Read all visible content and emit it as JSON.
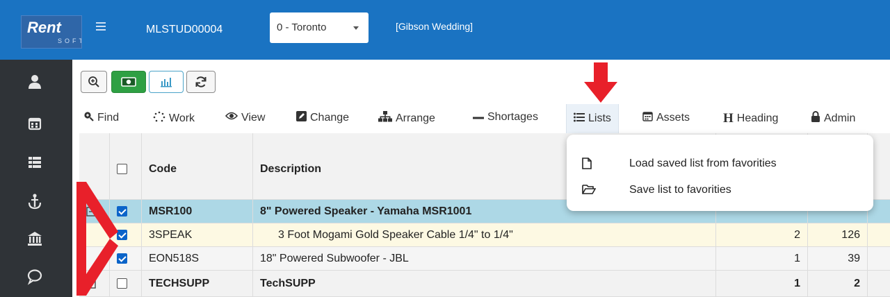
{
  "topbar": {
    "logo_text": "Rent",
    "logo_sub": "SOFT",
    "order_id": "MLSTUD00004",
    "location": "0 - Toronto",
    "event_name": "[Gibson Wedding]"
  },
  "sidebar": {
    "items": [
      "user-icon",
      "calendar-icon",
      "list-icon",
      "anchor-icon",
      "bank-icon",
      "chat-icon"
    ]
  },
  "toolbar": {
    "buttons": [
      "zoom-icon",
      "money-icon",
      "bar-chart-icon",
      "refresh-icon"
    ]
  },
  "nav": {
    "find": "Find",
    "work": "Work",
    "view": "View",
    "change": "Change",
    "arrange": "Arrange",
    "shortages": "Shortages",
    "lists": "Lists",
    "assets": "Assets",
    "heading": "Heading",
    "admin": "Admin"
  },
  "table": {
    "headers": {
      "code": "Code",
      "description": "Description"
    },
    "rows": [
      {
        "code": "MSR100",
        "description": "8\" Powered Speaker - Yamaha MSR1001",
        "checked": true,
        "bold": true,
        "qty": "",
        "avail": ""
      },
      {
        "code": "3SPEAK",
        "description": "3 Foot Mogami Gold Speaker Cable 1/4\" to 1/4\"",
        "checked": true,
        "bold": false,
        "qty": "2",
        "avail": "126"
      },
      {
        "code": "EON518S",
        "description": "18\" Powered Subwoofer - JBL",
        "checked": true,
        "bold": false,
        "qty": "1",
        "avail": "39"
      },
      {
        "code": "TECHSUPP",
        "description": "TechSUPP",
        "checked": false,
        "bold": true,
        "qty": "1",
        "avail": "2"
      }
    ]
  },
  "dropdown": {
    "load_label": "Load saved list from favorities",
    "save_label": "Save list to favorities"
  },
  "colors": {
    "topbar": "#1a73c2",
    "sidebar": "#2f3337",
    "selected_row": "#add8e6",
    "highlight_row": "#fdf9e3",
    "annotation": "#e8202a"
  }
}
